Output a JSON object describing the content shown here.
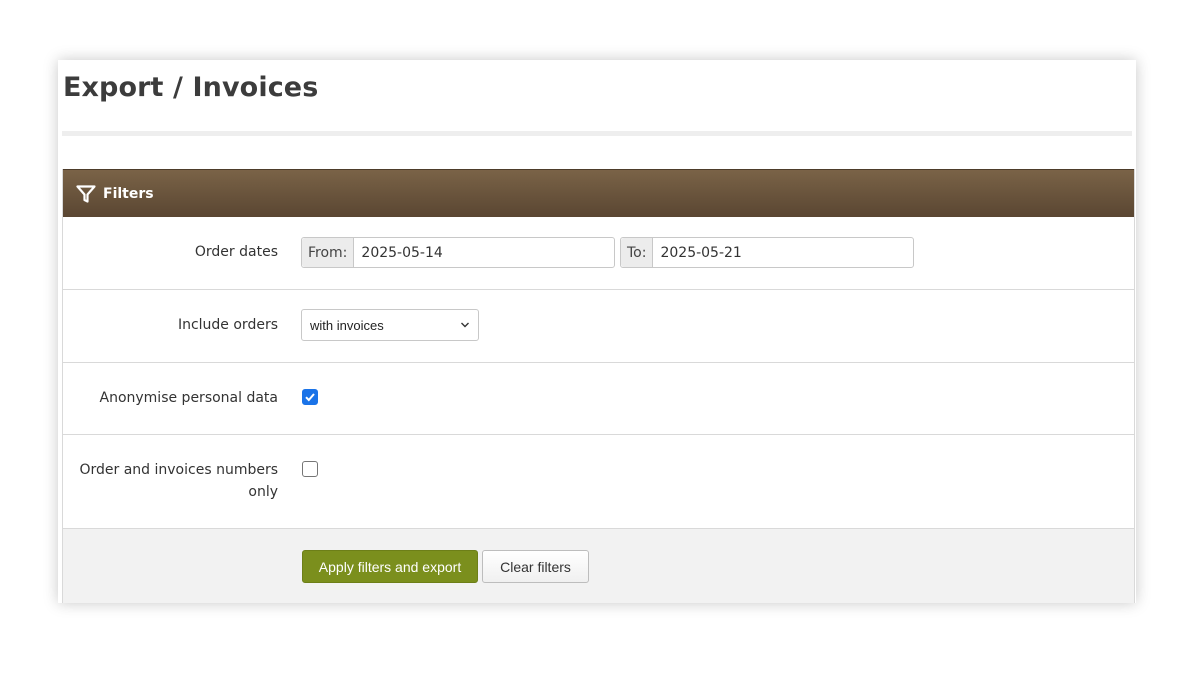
{
  "page": {
    "title": "Export / Invoices"
  },
  "filters": {
    "header_title": "Filters",
    "header_icon": "funnel-icon",
    "colors": {
      "header": "#6b5640",
      "primary_button": "#7b8f1d",
      "checkbox_checked": "#1a73e8"
    },
    "order_dates": {
      "label": "Order dates",
      "from_prefix": "From:",
      "from_value": "2025-05-14",
      "to_prefix": "To:",
      "to_value": "2025-05-21"
    },
    "include_orders": {
      "label": "Include orders",
      "selected": "with invoices",
      "icon": "chevron-down-icon"
    },
    "anonymise": {
      "label": "Anonymise personal data",
      "checked": true
    },
    "numbers_only": {
      "label_line1": "Order and invoices numbers",
      "label_line2": "only",
      "checked": false
    },
    "actions": {
      "apply_label": "Apply filters and export",
      "clear_label": "Clear filters"
    }
  }
}
